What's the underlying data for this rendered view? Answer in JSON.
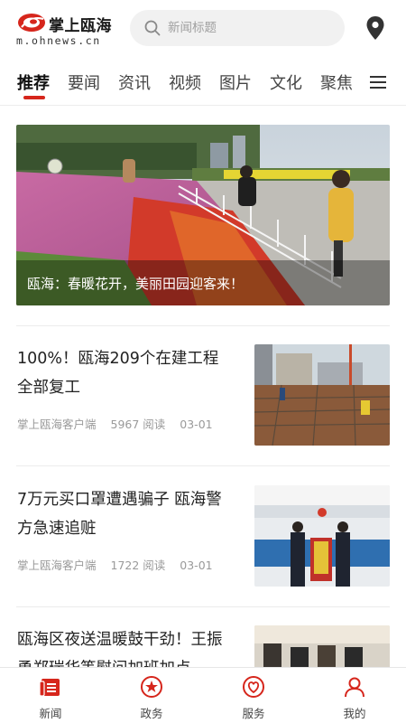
{
  "header": {
    "logo_title": "掌上瓯海",
    "logo_domain": "m.ohnews.cn",
    "search_placeholder": "新闻标题"
  },
  "tabs": [
    {
      "label": "推荐",
      "active": true
    },
    {
      "label": "要闻"
    },
    {
      "label": "资讯"
    },
    {
      "label": "视频"
    },
    {
      "label": "图片"
    },
    {
      "label": "文化"
    },
    {
      "label": "聚焦"
    }
  ],
  "hero": {
    "caption": "瓯海：春暖花开，美丽田园迎客来！"
  },
  "news": [
    {
      "title": "100%！瓯海209个在建工程全部复工",
      "source": "掌上瓯海客户端",
      "reads": "5967 阅读",
      "date": "03-01"
    },
    {
      "title": "7万元买口罩遭遇骗子 瓯海警方急速追赃",
      "source": "掌上瓯海客户端",
      "reads": "1722 阅读",
      "date": "03-01"
    },
    {
      "title": "瓯海区夜送温暖鼓干劲！王振勇郑瑞华等慰问加班加点"
    }
  ],
  "bottom_nav": [
    {
      "label": "新闻",
      "icon": "news-icon",
      "active": true
    },
    {
      "label": "政务",
      "icon": "government-icon"
    },
    {
      "label": "服务",
      "icon": "service-icon"
    },
    {
      "label": "我的",
      "icon": "profile-icon"
    }
  ],
  "colors": {
    "accent": "#d6261c",
    "text": "#222222",
    "meta": "#9a9a9a"
  }
}
